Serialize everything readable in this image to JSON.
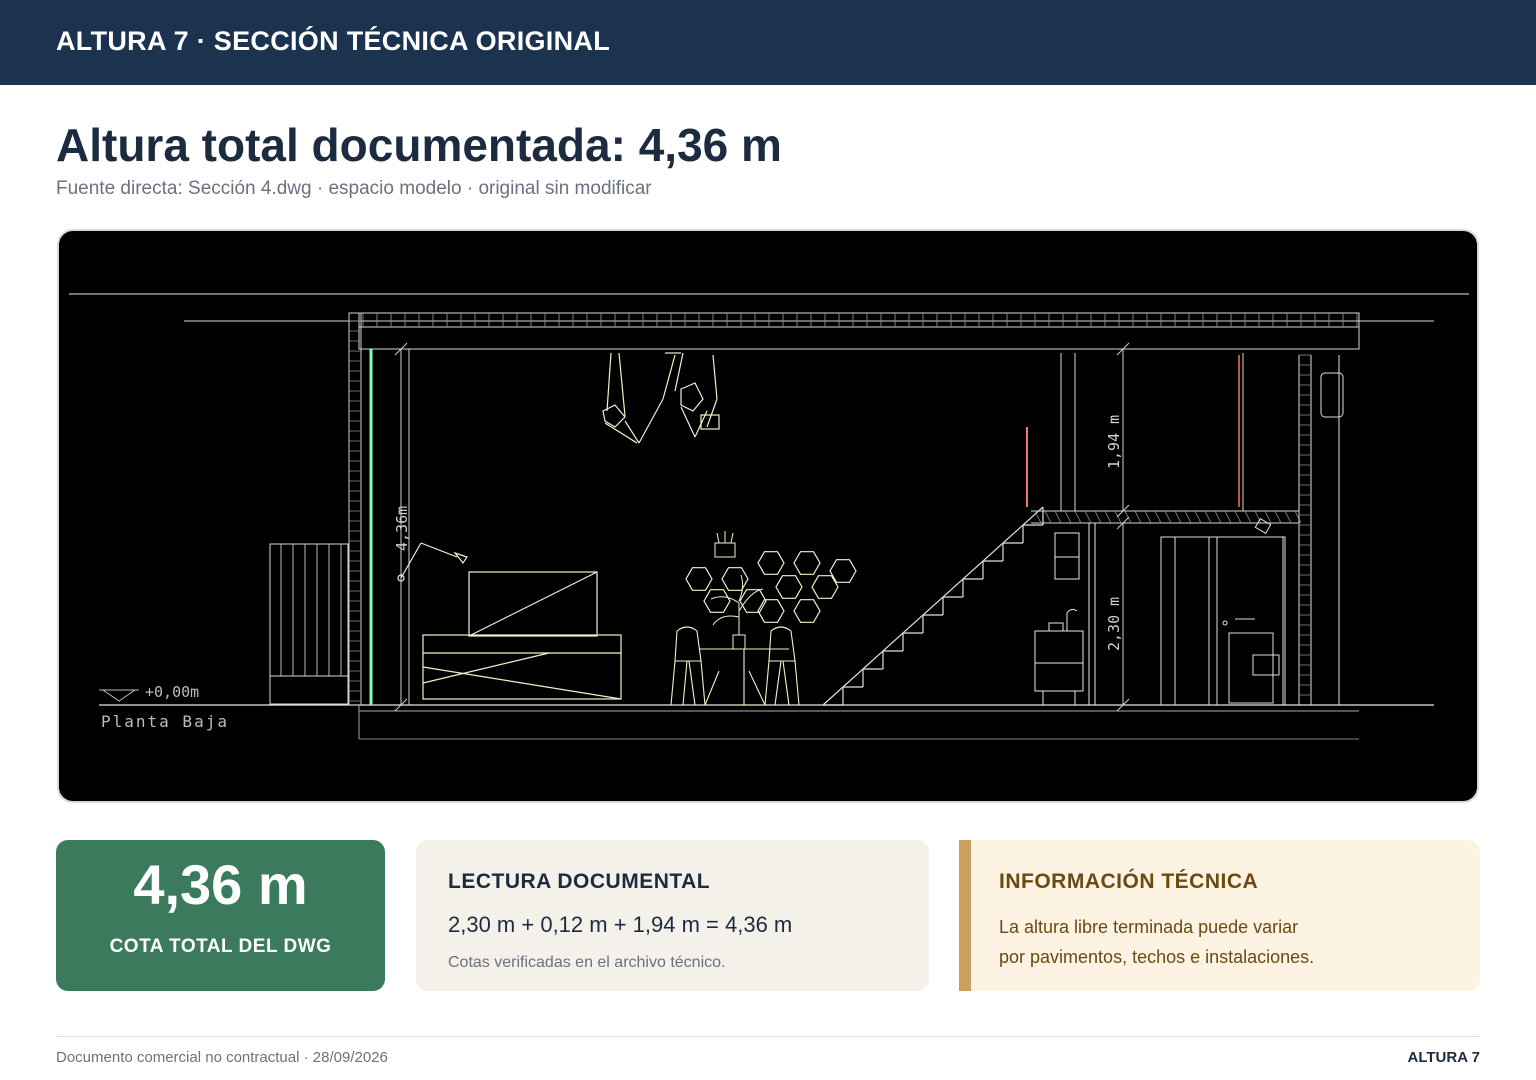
{
  "header": {
    "title": "ALTURA 7 · SECCIÓN TÉCNICA ORIGINAL"
  },
  "main": {
    "headline": "Altura total documentada: 4,36 m",
    "source_line": "Fuente directa: Sección 4.dwg · espacio modelo · original sin modificar"
  },
  "drawing": {
    "level_mark": "+0,00m",
    "level_name": "Planta Baja",
    "dim_total": "4,36m",
    "dim_upper": "1,94 m",
    "dim_lower": "2,30 m",
    "colors": {
      "background": "#000000",
      "lines": "#e8e8e8",
      "furniture": "#eef5c8",
      "accent_green": "#7fffb0",
      "accent_red": "#ff6f6f"
    }
  },
  "cards": {
    "total": {
      "value": "4,36 m",
      "label": "COTA TOTAL DEL DWG",
      "color": "#3b7a5c"
    },
    "document": {
      "title": "LECTURA DOCUMENTAL",
      "formula": "2,30 m + 0,12 m + 1,94 m = 4,36 m",
      "note": "Cotas verificadas en el archivo técnico."
    },
    "info": {
      "title": "INFORMACIÓN TÉCNICA",
      "line1": "La altura libre terminada puede variar",
      "line2": "por pavimentos, techos e instalaciones.",
      "accent": "#c9a15c"
    }
  },
  "footer": {
    "left": "Documento comercial no contractual · 28/09/2026",
    "right": "ALTURA 7"
  }
}
